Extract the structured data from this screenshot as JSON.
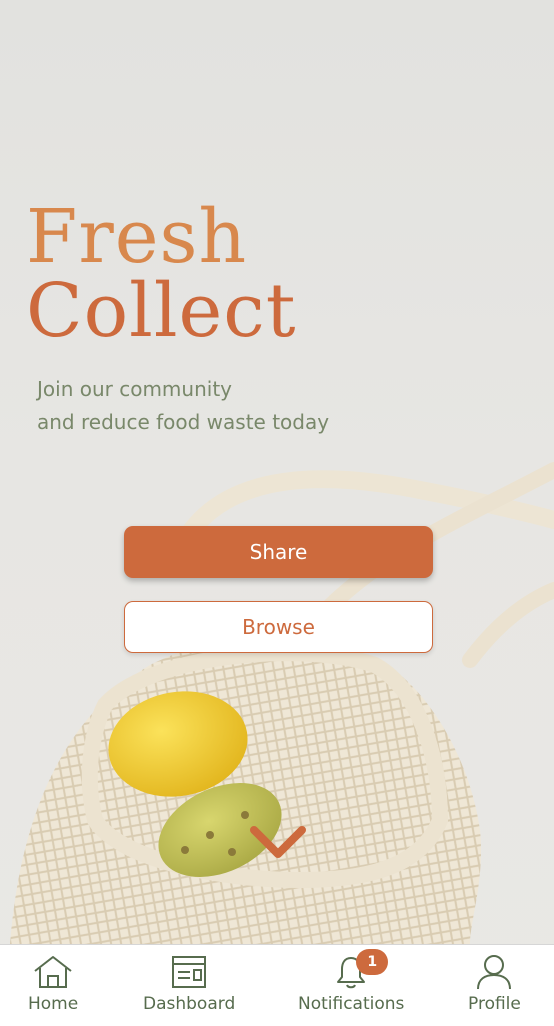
{
  "app": {
    "title_line1": "Fresh",
    "title_line2": "Collect",
    "tagline_line1": "Join our community",
    "tagline_line2": "and reduce food waste today"
  },
  "actions": {
    "share_label": "Share",
    "browse_label": "Browse"
  },
  "nav": {
    "items": [
      {
        "label": "Home",
        "icon": "home-icon"
      },
      {
        "label": "Dashboard",
        "icon": "dashboard-icon"
      },
      {
        "label": "Notifications",
        "icon": "bell-icon",
        "badge": "1"
      },
      {
        "label": "Profile",
        "icon": "user-icon"
      }
    ]
  },
  "colors": {
    "accent": "#cd6a3d",
    "title_light": "#d8884d",
    "tagline": "#79886a",
    "nav_text": "#576c4e"
  }
}
